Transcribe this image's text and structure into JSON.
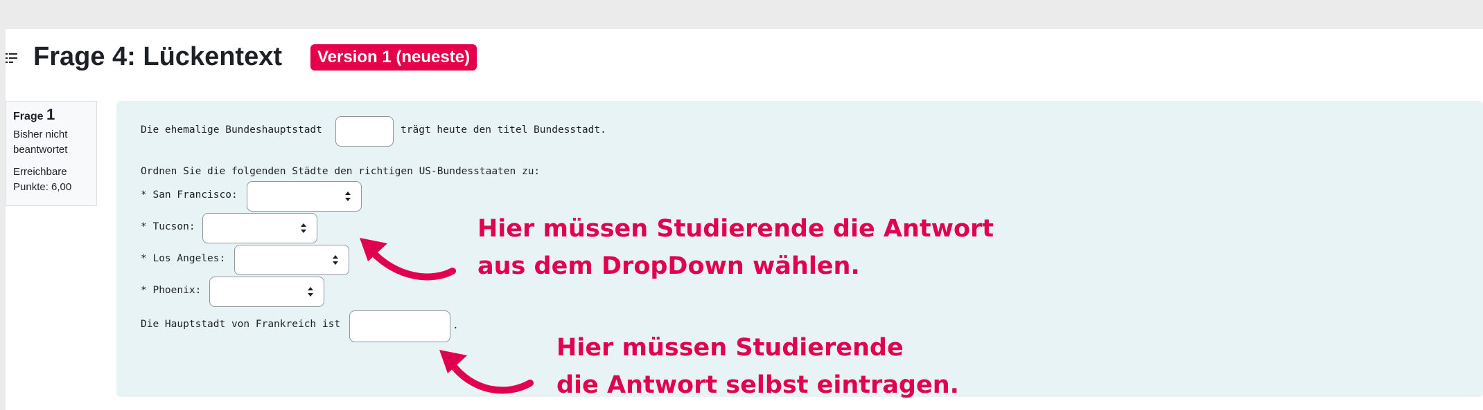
{
  "header": {
    "title": "Frage 4: Lückentext",
    "version_badge": "Version 1 (neueste)",
    "icon": "drag-handle-icon"
  },
  "question_info": {
    "label": "Frage",
    "number": "1",
    "state": "Bisher nicht beantwortet",
    "grade": "Erreichbare Punkte: 6,00"
  },
  "question": {
    "line1_before": "Die ehemalige Bundeshauptstadt",
    "line1_after": "trägt heute den titel Bundesstadt.",
    "instruction": "Ordnen Sie die folgenden Städte den richtigen US-Bundesstaaten zu:",
    "items": [
      {
        "label": "* San Francisco:"
      },
      {
        "label": "* Tucson:"
      },
      {
        "label": "* Los Angeles:"
      },
      {
        "label": "* Phoenix:"
      }
    ],
    "last_line_before": "Die Hauptstadt von Frankreich ist",
    "last_line_after": "."
  },
  "annotations": {
    "dropdown_line1": "Hier müssen Studierende die Antwort",
    "dropdown_line2": "aus dem DropDown wählen.",
    "textentry_line1": "Hier müssen Studierende",
    "textentry_line2": "die Antwort selbst eintragen.",
    "color": "#e0004d"
  },
  "colors": {
    "badge": "#e6004c",
    "content_bg": "#e7f3f5"
  }
}
